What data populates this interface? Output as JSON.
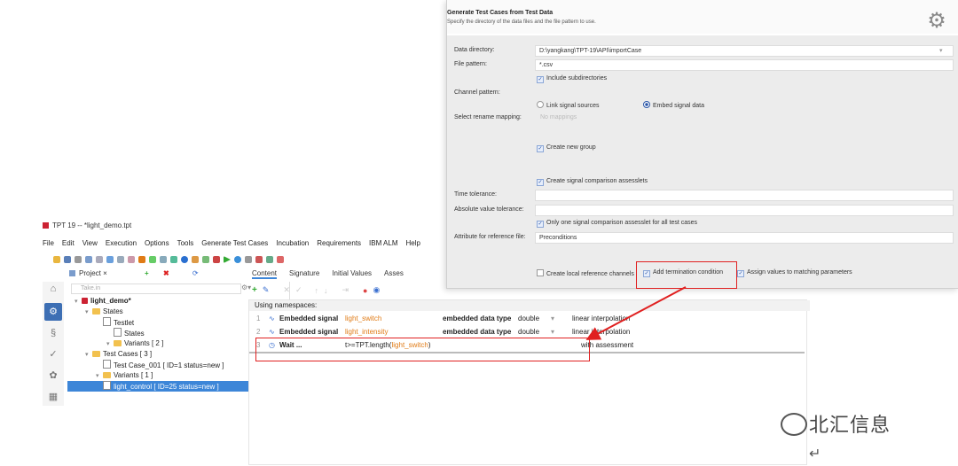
{
  "main_window": {
    "title": "TPT 19 -- *light_demo.tpt",
    "menu": [
      "File",
      "Edit",
      "View",
      "Execution",
      "Options",
      "Tools",
      "Generate Test Cases",
      "Incubation",
      "Requirements",
      "IBM ALM",
      "Help"
    ],
    "project_tab": "Project",
    "filter_placeholder": "Take.in",
    "tree": [
      {
        "label": "light_demo*",
        "indent": 0,
        "type": "root"
      },
      {
        "label": "States",
        "indent": 1,
        "type": "folder"
      },
      {
        "label": "Testlet",
        "indent": 2,
        "type": "doc"
      },
      {
        "label": "States",
        "indent": 3,
        "type": "doc"
      },
      {
        "label": "Variants  [ 2 ]",
        "indent": 3,
        "type": "folder"
      },
      {
        "label": "Test Cases  [ 3 ]",
        "indent": 1,
        "type": "folder"
      },
      {
        "label": "Test Case_001  [ ID=1 status=new ]",
        "indent": 2,
        "type": "doc"
      },
      {
        "label": "Variants  [ 1 ]",
        "indent": 2,
        "type": "folder"
      },
      {
        "label": "light_control  [ ID=25 status=new ]",
        "indent": 2,
        "type": "doc",
        "selected": true
      }
    ],
    "content_tabs": [
      "Content",
      "Signature",
      "Initial Values",
      "Asses"
    ],
    "namespaces_label": "Using namespaces:",
    "steps": [
      {
        "num": "1",
        "kind": "Embedded signal",
        "signal": "light_switch",
        "dtype_label": "embedded data type",
        "dtype": "double",
        "interp": "linear interpolation"
      },
      {
        "num": "2",
        "kind": "Embedded signal",
        "signal": "light_intensity",
        "dtype_label": "embedded data type",
        "dtype": "double",
        "interp": "linear interpolation"
      },
      {
        "num": "3",
        "kind": "Wait ...",
        "expr_prefix": "t>=TPT.length(",
        "expr_signal": "light_switch",
        "expr_suffix": ")",
        "extra": "with assessment"
      }
    ]
  },
  "dialog": {
    "title": "Generate Test Cases from Test Data",
    "subtitle": "Specify the directory of the data files and the file pattern to use.",
    "data_directory_label": "Data directory:",
    "data_directory_value": "D:\\yangkang\\TPT-19\\API\\importCase",
    "file_pattern_label": "File pattern:",
    "file_pattern_value": "*.csv",
    "include_subdirs": "Include subdirectories",
    "channel_pattern_label": "Channel pattern:",
    "link_signal_sources": "Link signal sources",
    "embed_signal_data": "Embed signal data",
    "select_rename_label": "Select rename mapping:",
    "select_rename_hint": "No mappings",
    "create_new_group": "Create new group",
    "create_signal_comparison": "Create signal comparison assesslets",
    "time_tolerance_label": "Time tolerance:",
    "abs_tolerance_label": "Absolute value tolerance:",
    "only_one_assesslet": "Only one signal comparison assesslet for all test cases",
    "attribute_ref_label": "Attribute for reference file:",
    "attribute_ref_value": "Preconditions",
    "create_local_ref": "Create local reference channels",
    "add_termination": "Add termination condition",
    "assign_values": "Assign values to matching parameters"
  },
  "watermark": "北汇信息",
  "colors": {
    "accent": "#3d86d8",
    "highlight": "#e02020",
    "signal": "#e07b16"
  }
}
